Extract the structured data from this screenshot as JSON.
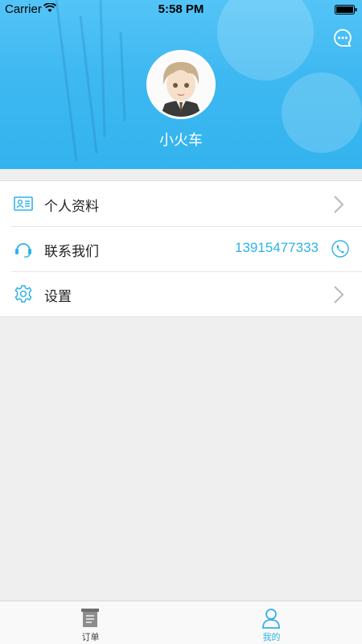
{
  "status_bar": {
    "carrier": "Carrier",
    "time": "5:58 PM"
  },
  "profile": {
    "username": "小火车"
  },
  "menu": {
    "items": [
      {
        "label": "个人资料",
        "icon": "id-card-icon"
      },
      {
        "label": "联系我们",
        "icon": "headset-icon",
        "phone": "13915477333"
      },
      {
        "label": "设置",
        "icon": "gear-icon"
      }
    ]
  },
  "tabbar": {
    "tabs": [
      {
        "label": "订单",
        "icon": "document-icon",
        "active": false
      },
      {
        "label": "我的",
        "icon": "person-icon",
        "active": true
      }
    ]
  },
  "colors": {
    "header_blue": "#3eb8f1",
    "accent": "#2fb2e9"
  }
}
